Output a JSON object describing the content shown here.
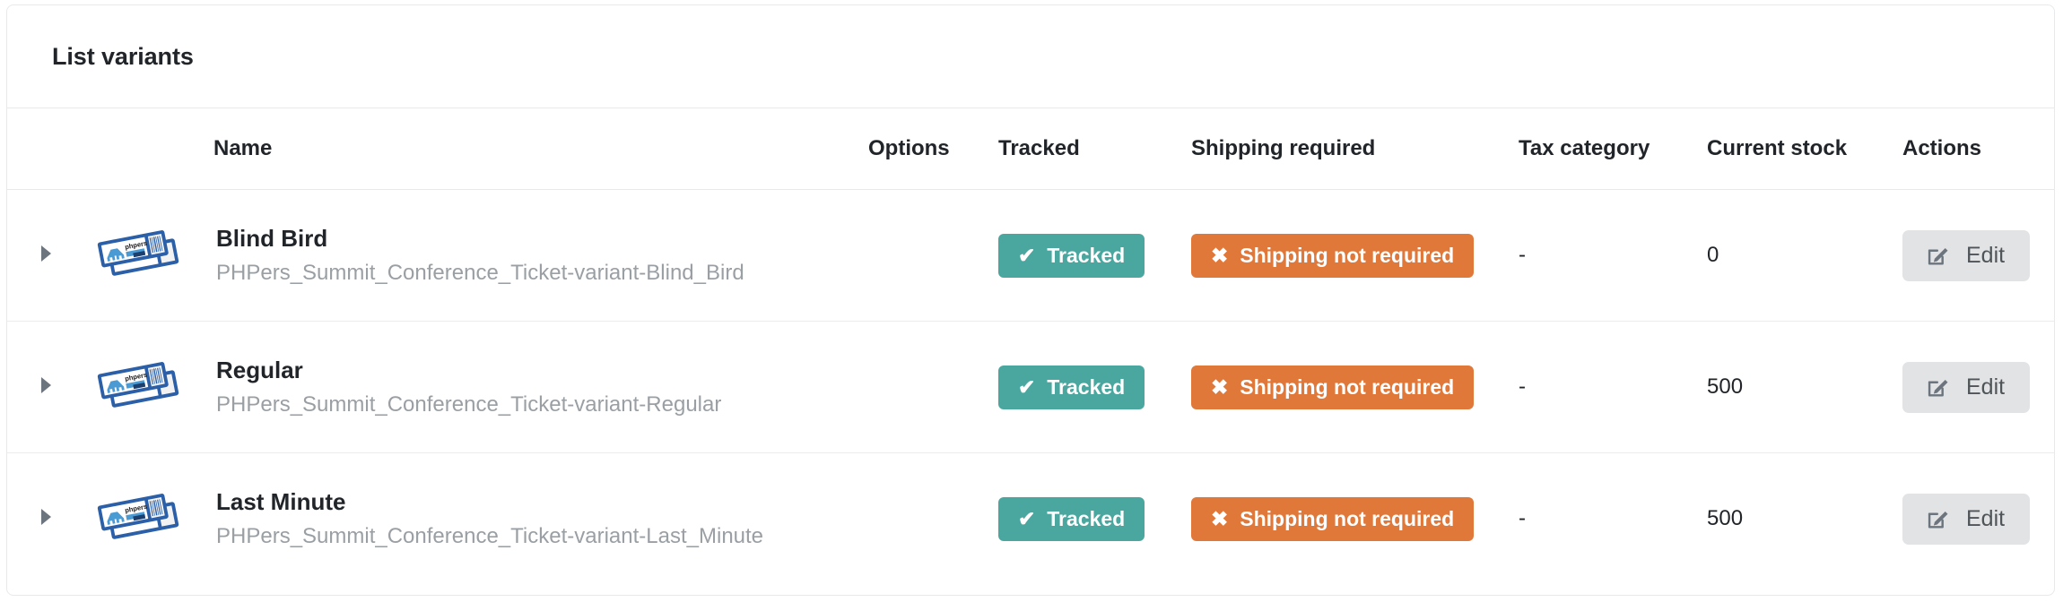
{
  "card": {
    "title": "List variants"
  },
  "table": {
    "columns": [
      {
        "key": "caret",
        "label": ""
      },
      {
        "key": "thumb",
        "label": ""
      },
      {
        "key": "name",
        "label": "Name"
      },
      {
        "key": "options",
        "label": "Options"
      },
      {
        "key": "tracked",
        "label": "Tracked"
      },
      {
        "key": "shipping",
        "label": "Shipping required"
      },
      {
        "key": "tax",
        "label": "Tax category"
      },
      {
        "key": "stock",
        "label": "Current stock"
      },
      {
        "key": "actions",
        "label": "Actions"
      }
    ],
    "rows": [
      {
        "name": "Blind Bird",
        "code": "PHPers_Summit_Conference_Ticket-variant-Blind_Bird",
        "thumb_icon": "ticket-thumbnail",
        "caret_icon": "caret-right-icon",
        "options": "",
        "tracked_label": "Tracked",
        "tracked_icon": "check-icon",
        "shipping_label": "Shipping not required",
        "shipping_icon": "cross-icon",
        "tax_category": "-",
        "current_stock": "0",
        "edit_label": "Edit",
        "edit_icon": "pen-to-square-icon"
      },
      {
        "name": "Regular",
        "code": "PHPers_Summit_Conference_Ticket-variant-Regular",
        "thumb_icon": "ticket-thumbnail",
        "caret_icon": "caret-right-icon",
        "options": "",
        "tracked_label": "Tracked",
        "tracked_icon": "check-icon",
        "shipping_label": "Shipping not required",
        "shipping_icon": "cross-icon",
        "tax_category": "-",
        "current_stock": "500",
        "edit_label": "Edit",
        "edit_icon": "pen-to-square-icon"
      },
      {
        "name": "Last Minute",
        "code": "PHPers_Summit_Conference_Ticket-variant-Last_Minute",
        "thumb_icon": "ticket-thumbnail",
        "caret_icon": "caret-right-icon",
        "options": "",
        "tracked_label": "Tracked",
        "tracked_icon": "check-icon",
        "shipping_label": "Shipping not required",
        "shipping_icon": "cross-icon",
        "tax_category": "-",
        "current_stock": "500",
        "edit_label": "Edit",
        "edit_icon": "pen-to-square-icon"
      }
    ]
  },
  "glyphs": {
    "check": "✔",
    "cross": "✖"
  },
  "colors": {
    "tracked_badge": "#4aa79f",
    "shipping_badge": "#e0783a",
    "edit_button": "#e2e3e5",
    "card_border": "#e7e9eb",
    "muted_text": "#9a9fa4",
    "ticket_blue": "#2b5fa8",
    "elephant_blue": "#4a9ad4"
  }
}
